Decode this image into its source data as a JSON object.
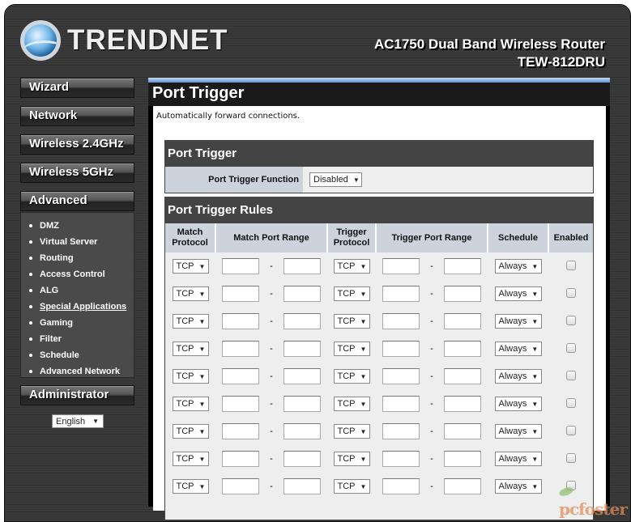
{
  "header": {
    "logo_text": "TRENDNET",
    "product_line1": "AC1750 Dual Band Wireless Router",
    "product_line2": "TEW-812DRU"
  },
  "sidebar": {
    "buttons": [
      "Wizard",
      "Network",
      "Wireless 2.4GHz",
      "Wireless 5GHz",
      "Advanced"
    ],
    "advanced_items": [
      "DMZ",
      "Virtual Server",
      "Routing",
      "Access Control",
      "ALG",
      "Special Applications",
      "Gaming",
      "Filter",
      "Schedule",
      "Advanced Network"
    ],
    "active_item": "Special Applications",
    "admin_button": "Administrator",
    "language": "English"
  },
  "main": {
    "title": "Port Trigger",
    "description": "Automatically forward connections.",
    "port_trigger": {
      "header": "Port Trigger",
      "function_label": "Port Trigger Function",
      "function_value": "Disabled"
    },
    "rules": {
      "header": "Port Trigger Rules",
      "columns": [
        "Match Protocol",
        "Match Port Range",
        "Trigger Protocol",
        "Trigger Port Range",
        "Schedule",
        "Enabled"
      ],
      "range_separator": "-",
      "rows": [
        {
          "match_protocol": "TCP",
          "trigger_protocol": "TCP",
          "schedule": "Always",
          "enabled": false
        },
        {
          "match_protocol": "TCP",
          "trigger_protocol": "TCP",
          "schedule": "Always",
          "enabled": false
        },
        {
          "match_protocol": "TCP",
          "trigger_protocol": "TCP",
          "schedule": "Always",
          "enabled": false
        },
        {
          "match_protocol": "TCP",
          "trigger_protocol": "TCP",
          "schedule": "Always",
          "enabled": false
        },
        {
          "match_protocol": "TCP",
          "trigger_protocol": "TCP",
          "schedule": "Always",
          "enabled": false
        },
        {
          "match_protocol": "TCP",
          "trigger_protocol": "TCP",
          "schedule": "Always",
          "enabled": false
        },
        {
          "match_protocol": "TCP",
          "trigger_protocol": "TCP",
          "schedule": "Always",
          "enabled": false
        },
        {
          "match_protocol": "TCP",
          "trigger_protocol": "TCP",
          "schedule": "Always",
          "enabled": false
        },
        {
          "match_protocol": "TCP",
          "trigger_protocol": "TCP",
          "schedule": "Always",
          "enabled": false
        }
      ]
    }
  },
  "watermark": "pcfoster"
}
